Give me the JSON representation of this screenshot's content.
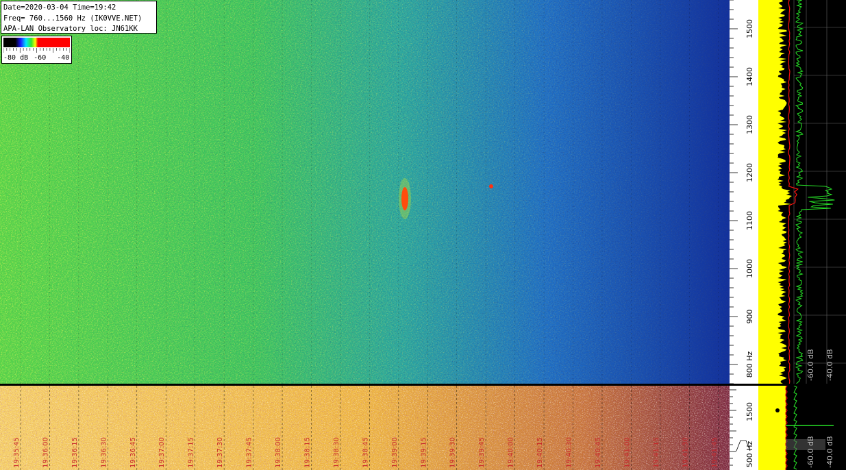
{
  "info": {
    "date_line": "Date=2020-03-04 Time=19:42",
    "freq_line": "Freq= 760...1560 Hz (IK0VVE.NET)",
    "observatory_line": "APA-LAN Observatory loc: JN61KK"
  },
  "legend": {
    "labels": [
      "-80 dB",
      "-60",
      "-40"
    ],
    "colors": [
      "#000000",
      "#1a1aff",
      "#00e5ff",
      "#2ee82e",
      "#ffff00",
      "#ff0000"
    ]
  },
  "freq_axis": {
    "ticks": [
      "1500",
      "1400",
      "1300",
      "1200",
      "1100",
      "1000",
      "900",
      "800 Hz"
    ]
  },
  "bottom_freq_axis": {
    "ticks": [
      "1500",
      "500 Hz"
    ]
  },
  "spectrum_axis": {
    "labels": [
      "-60.0 dB",
      "-40.0 dB"
    ]
  },
  "bottom_spectrum_axis": {
    "labels": [
      "-60.0 dB",
      "-40.0 dB"
    ]
  },
  "time_axis": {
    "labels": [
      "19:35:45",
      "19:36:00",
      "19:36:15",
      "19:36:30",
      "19:36:45",
      "19:37:00",
      "19:37:15",
      "19:37:30",
      "19:37:45",
      "19:38:00",
      "19:38:15",
      "19:38:30",
      "19:38:45",
      "19:39:00",
      "19:39:15",
      "19:39:30",
      "19:39:45",
      "19:40:00",
      "19:40:15",
      "19:40:30",
      "19:40:45",
      "19:41:00",
      "19:41:15",
      "19:41:30",
      "19:41:45"
    ]
  },
  "colors": {
    "label_red": "#c8262a",
    "signal_red": "#ff1010",
    "spectrum_yellow": "#ffff00",
    "spectrum_green": "#27e327"
  }
}
